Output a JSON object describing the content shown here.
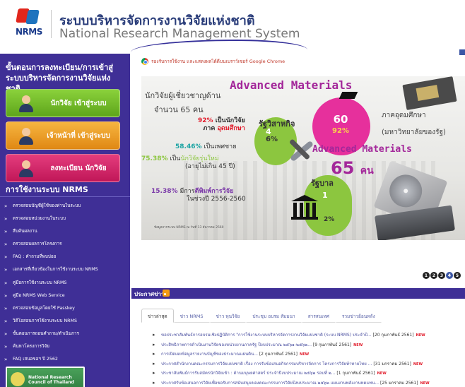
{
  "header": {
    "logo_text": "NRMS",
    "title_th": "ระบบบริหารจัดการงานวิจัยแห่งชาติ",
    "title_en": "National Research Management System"
  },
  "sidebar": {
    "heading": "ขั้นตอนการลงทะเบียน/การเข้าสู่ระบบบริหารจัดการงานวิจัยแห่งชาติ",
    "buttons": [
      {
        "label": "นักวิจัย เข้าสู่ระบบ",
        "color": "#6fb928"
      },
      {
        "label": "เจ้าหน้าที่ เข้าสู่ระบบ",
        "color": "#ee9f25"
      },
      {
        "label": "ลงทะเบียน นักวิจัย",
        "color": "#d52a6b"
      }
    ],
    "section_title": "การใช้งานระบบ NRMS",
    "links": [
      "ตรวจสอบบัญชีผู้ใช้ของท่านในระบบ",
      "ตรวจสอบหน่วยงานในระบบ",
      "สืบค้นผลงาน",
      "ตรวจสอบผลการโครงการ",
      "FAQ : คำถามที่พบบ่อย",
      "เอกสารที่เกี่ยวข้องในการใช้งานระบบ NRMS",
      "คู่มือการใช้งานระบบ NRMS",
      "คู่มือ NRMS Web Service",
      "ตรวจสอบข้อมูลโดยใช้ Passkey",
      "วิดีโอสอนการใช้งานระบบ NRMS",
      "ขั้นตอนการถอนคำถาม/ดำเนินการ",
      "ค้นหาโครงการวิจัย",
      "FAQ เสนอขอฯ ปี 2562"
    ],
    "bottom_logo_text": "National Research Council of Thailand"
  },
  "chrome_note": "รองรับการใช้งาน และแสดงผลได้ดีบนเบราว์เซอร์ Google Chrome",
  "banner": {
    "title": "Advanced Materials",
    "line1": "นักวิจัยผู้เชี่ยวชาญด้าน",
    "line2": "จำนวน 65 คน",
    "stat1_pct": "92%",
    "stat1_a": "เป็นนักวิจัย",
    "stat1_b": "ภาค",
    "stat1_c": "อุดมศึกษา",
    "stat2_pct": "58.46%",
    "stat2_text": "เป็นเพศชาย",
    "stat3_pct": "75.38%",
    "stat3_a": "เป็น",
    "stat3_b": "นักวิจัยรุ่นใหม่",
    "stat3_c": "(อายุไม่เกิน 45 ปี)",
    "stat4_pct": "15.38%",
    "stat4_a": "มีการ",
    "stat4_b": "ตีพิมพ์การวิจัย",
    "stat4_c": "ในช่วงปี 2556-2560",
    "edu_num": "60",
    "edu_pct": "92%",
    "edu_l1": "ภาคอุดมศึกษา",
    "edu_l2": "(มหาวิทยาลัยของรัฐ)",
    "private_l1": "รัฐวิสาหกิจ",
    "private_num": "4",
    "private_pct": "6%",
    "big_title": "Advanced Materials",
    "big_num": "65",
    "big_unit": "คน",
    "gov_l1": "รัฐบาล",
    "gov_num": "1",
    "gov_pct": "2%",
    "footnote": "ข้อมูลจากระบบ NRMS ณ วันที่ 13 ธันวาคม 2560"
  },
  "pager": [
    "1",
    "2",
    "3",
    "4",
    "5"
  ],
  "news": {
    "title": "ประกาศข่าว",
    "tabs": [
      "ข่าวล่าสุด",
      "ข่าว NRMS",
      "ข่าว ทุนวิจัย",
      "ประชุม อบรม สัมมนา",
      "สารสนเทศ",
      "รวมข่าวย้อนหลัง"
    ],
    "new_label": "NEW",
    "items": [
      {
        "text": "ขอประชาสัมพันธ์การอบรมเชิงปฏิบัติการ \"การใช้งานระบบบริหารจัดการงานวิจัยแห่งชาติ (ระบบ NRMS) ประจำปี...",
        "date": "[20 กุมภาพันธ์ 2561]"
      },
      {
        "text": "ประสิทธิภาพการดำเนินงานวิจัยของหน่วยงานภาครัฐ ปีงบประมาณ ๒๕๖๑-๒๕๖๒...",
        "date": "[9 กุมภาพันธ์ 2561]"
      },
      {
        "text": "การเปิดเผยข้อมูลรายงานบัญชีของประมาณแผ่นดิน...",
        "date": "[2 กุมภาพันธ์ 2561]"
      },
      {
        "text": "ประกาศสำนักงานคณะกรรมการวิจัยแห่งชาติ เรื่อง การรับข้อเสนอกิจกรรมบริหารจัดการ โครงการวิจัยท้าทายไทย ...",
        "date": "[31 มกราคม 2561]"
      },
      {
        "text": "ประชาสัมพันธ์การรับสมัครนักวิจัยเข้า : ด้านมนุษยศาสตร์ ประจำปีงบประมาณ ๒๕๖๒ รอบที่ ๒...",
        "date": "[1 กุมภาพันธ์ 2561]"
      },
      {
        "text": "ประกาศรับข้อเสนอการวิจัยเพื่อขอรับการสนับสนุนของคณะกรรมการวิจัยปีงบประมาณ ๒๕๖๒ แผนงานพลังงานทดแทน...",
        "date": "[25 มกราคม 2561]"
      }
    ]
  }
}
